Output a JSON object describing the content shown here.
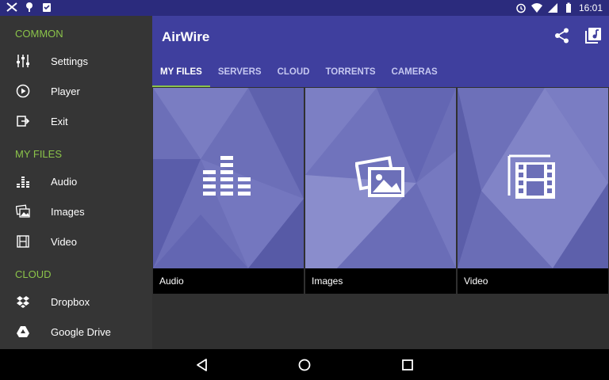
{
  "status": {
    "time": "16:01"
  },
  "drawer": {
    "sections": [
      {
        "label": "COMMON",
        "items": [
          {
            "label": "Settings",
            "icon": "settings-sliders-icon"
          },
          {
            "label": "Player",
            "icon": "play-circle-icon"
          },
          {
            "label": "Exit",
            "icon": "exit-icon"
          }
        ]
      },
      {
        "label": "MY FILES",
        "items": [
          {
            "label": "Audio",
            "icon": "equalizer-icon"
          },
          {
            "label": "Images",
            "icon": "images-icon"
          },
          {
            "label": "Video",
            "icon": "film-icon"
          }
        ]
      },
      {
        "label": "CLOUD",
        "items": [
          {
            "label": "Dropbox",
            "icon": "dropbox-icon"
          },
          {
            "label": "Google Drive",
            "icon": "google-drive-icon"
          }
        ]
      }
    ]
  },
  "appbar": {
    "title": "AirWire",
    "tabs": [
      "MY FILES",
      "SERVERS",
      "CLOUD",
      "TORRENTS",
      "CAMERAS"
    ],
    "active_tab": "MY FILES"
  },
  "tiles": [
    {
      "label": "Audio",
      "icon": "equalizer-icon"
    },
    {
      "label": "Images",
      "icon": "images-icon"
    },
    {
      "label": "Video",
      "icon": "film-icon"
    }
  ],
  "colors": {
    "appbar": "#3f3f9e",
    "statusbar": "#2b2b7d",
    "accent": "#8bc34a",
    "drawer": "#353535",
    "tile": "#6c6fb8"
  }
}
